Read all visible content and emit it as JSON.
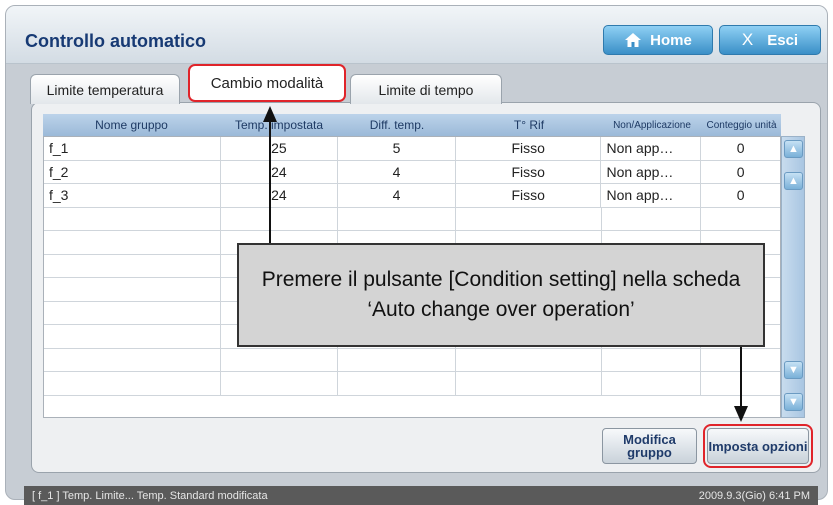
{
  "window": {
    "title": "Controllo automatico"
  },
  "topbar": {
    "home_label": "Home",
    "exit_x": "X",
    "exit_label": "Esci"
  },
  "tabs": [
    {
      "label": "Limite temperatura",
      "selected": false
    },
    {
      "label": "Cambio modalità",
      "selected": true
    },
    {
      "label": "Limite di tempo",
      "selected": false
    }
  ],
  "table": {
    "columns": [
      "Nome gruppo",
      "Temp. impostata",
      "Diff. temp.",
      "T° Rif",
      "Non/Applicazione",
      "Conteggio unità"
    ],
    "rows": [
      [
        "f_1",
        "25",
        "5",
        "Fisso",
        "Non app…",
        "0"
      ],
      [
        "f_2",
        "24",
        "4",
        "Fisso",
        "Non app…",
        "0"
      ],
      [
        "f_3",
        "24",
        "4",
        "Fisso",
        "Non app…",
        "0"
      ]
    ],
    "empty_rows": 8
  },
  "callout": {
    "text": "Premere il pulsante [Condition setting] nella scheda ‘Auto change over operation’"
  },
  "buttons": {
    "edit_group": "Modifica gruppo",
    "set_options": "Imposta opzioni"
  },
  "status": {
    "message": "[ f_1 ] Temp. Limite... Temp. Standard modificata",
    "datetime": "2009.9.3(Gio) 6:41 PM"
  },
  "colors": {
    "title": "#173a74",
    "highlight": "#e0242a",
    "button_blue": "#3a8fc7"
  }
}
